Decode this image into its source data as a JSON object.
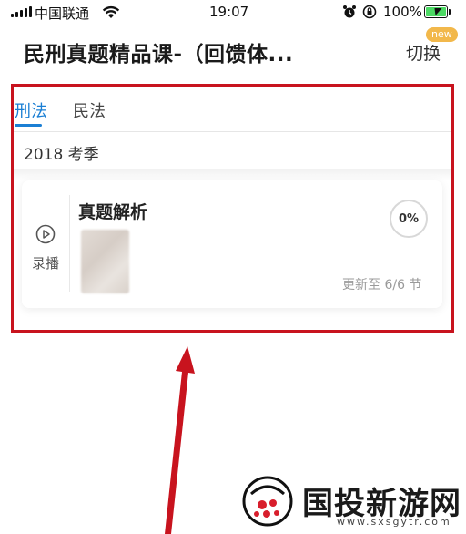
{
  "status_bar": {
    "carrier": "中国联通",
    "time": "19:07",
    "battery_percent": "100%",
    "icons": [
      "signal-icon",
      "wifi-icon",
      "alarm-icon",
      "orientation-lock-icon",
      "battery-charging-icon"
    ]
  },
  "header": {
    "title": "民刑真题精品课-（回馈体...",
    "switch_label": "切换",
    "new_badge": "new"
  },
  "tabs": [
    {
      "label": "刑法",
      "active": true
    },
    {
      "label": "民法",
      "active": false
    }
  ],
  "season": "2018 考季",
  "course_card": {
    "type_label": "录播",
    "title": "真题解析",
    "progress": "0%",
    "update_text": "更新至 6/6 节"
  },
  "watermark": {
    "text": "国投新游网",
    "url": "www.sxsgytr.com"
  },
  "colors": {
    "accent": "#1b7fd4",
    "highlight": "#c8131e",
    "badge": "#f2b84b",
    "battery": "#4cd964"
  }
}
